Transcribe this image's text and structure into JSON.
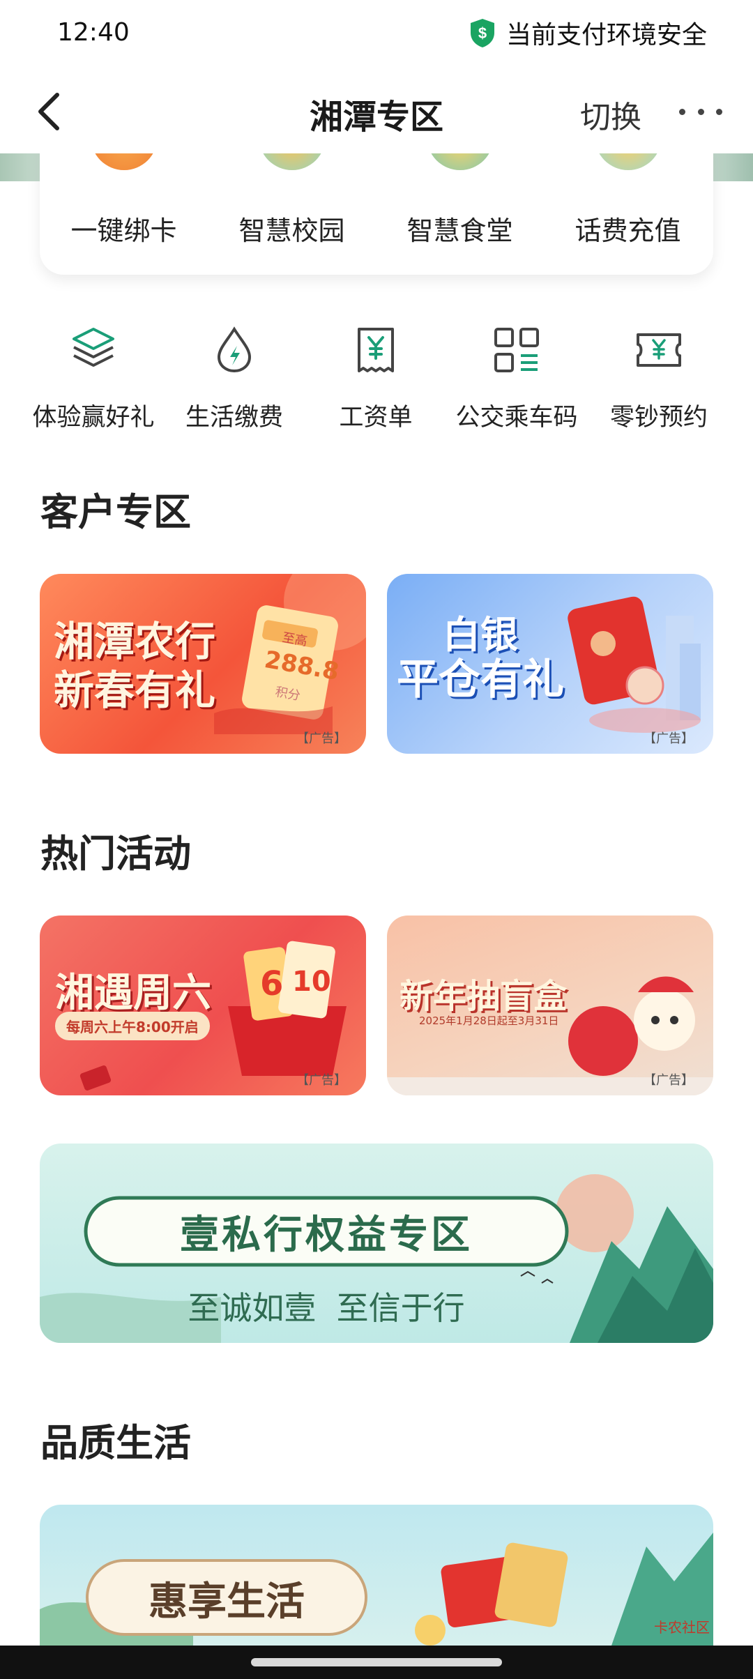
{
  "status": {
    "time": "12:40",
    "secure_text": "当前支付环境安全"
  },
  "nav": {
    "title": "湘潭专区",
    "switch_label": "切换"
  },
  "quick_actions": [
    {
      "label": "一键绑卡",
      "icon": "bind-card-icon"
    },
    {
      "label": "智慧校园",
      "icon": "campus-icon"
    },
    {
      "label": "智慧食堂",
      "icon": "canteen-icon"
    },
    {
      "label": "话费充值",
      "icon": "phone-recharge-icon"
    }
  ],
  "services": [
    {
      "label": "体验赢好礼",
      "icon": "layers-icon"
    },
    {
      "label": "生活缴费",
      "icon": "water-drop-icon"
    },
    {
      "label": "工资单",
      "icon": "receipt-yen-icon"
    },
    {
      "label": "公交乘车码",
      "icon": "qr-code-icon"
    },
    {
      "label": "零钞预约",
      "icon": "ticket-yen-icon"
    }
  ],
  "sections": {
    "customer": "客户专区",
    "hot": "热门活动",
    "quality": "品质生活"
  },
  "banners": {
    "customer": [
      {
        "headline_1": "湘潭农行",
        "headline_2": "新春有礼",
        "ticket_top": "至高",
        "ticket_value": "288.8",
        "ticket_bottom": "积分",
        "ad": "【广告】"
      },
      {
        "headline_1": "白银",
        "headline_2": "平仓有礼",
        "ad": "【广告】"
      }
    ],
    "hot": [
      {
        "headline": "湘遇周六",
        "sub": "每周六上午8:00开启",
        "ticket_a": "6",
        "ticket_b": "10",
        "ad": "【广告】"
      },
      {
        "headline": "新年抽盲盒",
        "sub": "2025年1月28日起至3月31日",
        "ad": "【广告】"
      }
    ],
    "private": {
      "headline": "壹私行权益专区",
      "slogan": "至诚如壹  至信于行"
    },
    "life": {
      "headline": "惠享生活"
    }
  },
  "watermark": "卡农社区",
  "colors": {
    "brand_green": "#1a9e78",
    "accent_red": "#e8432f"
  }
}
